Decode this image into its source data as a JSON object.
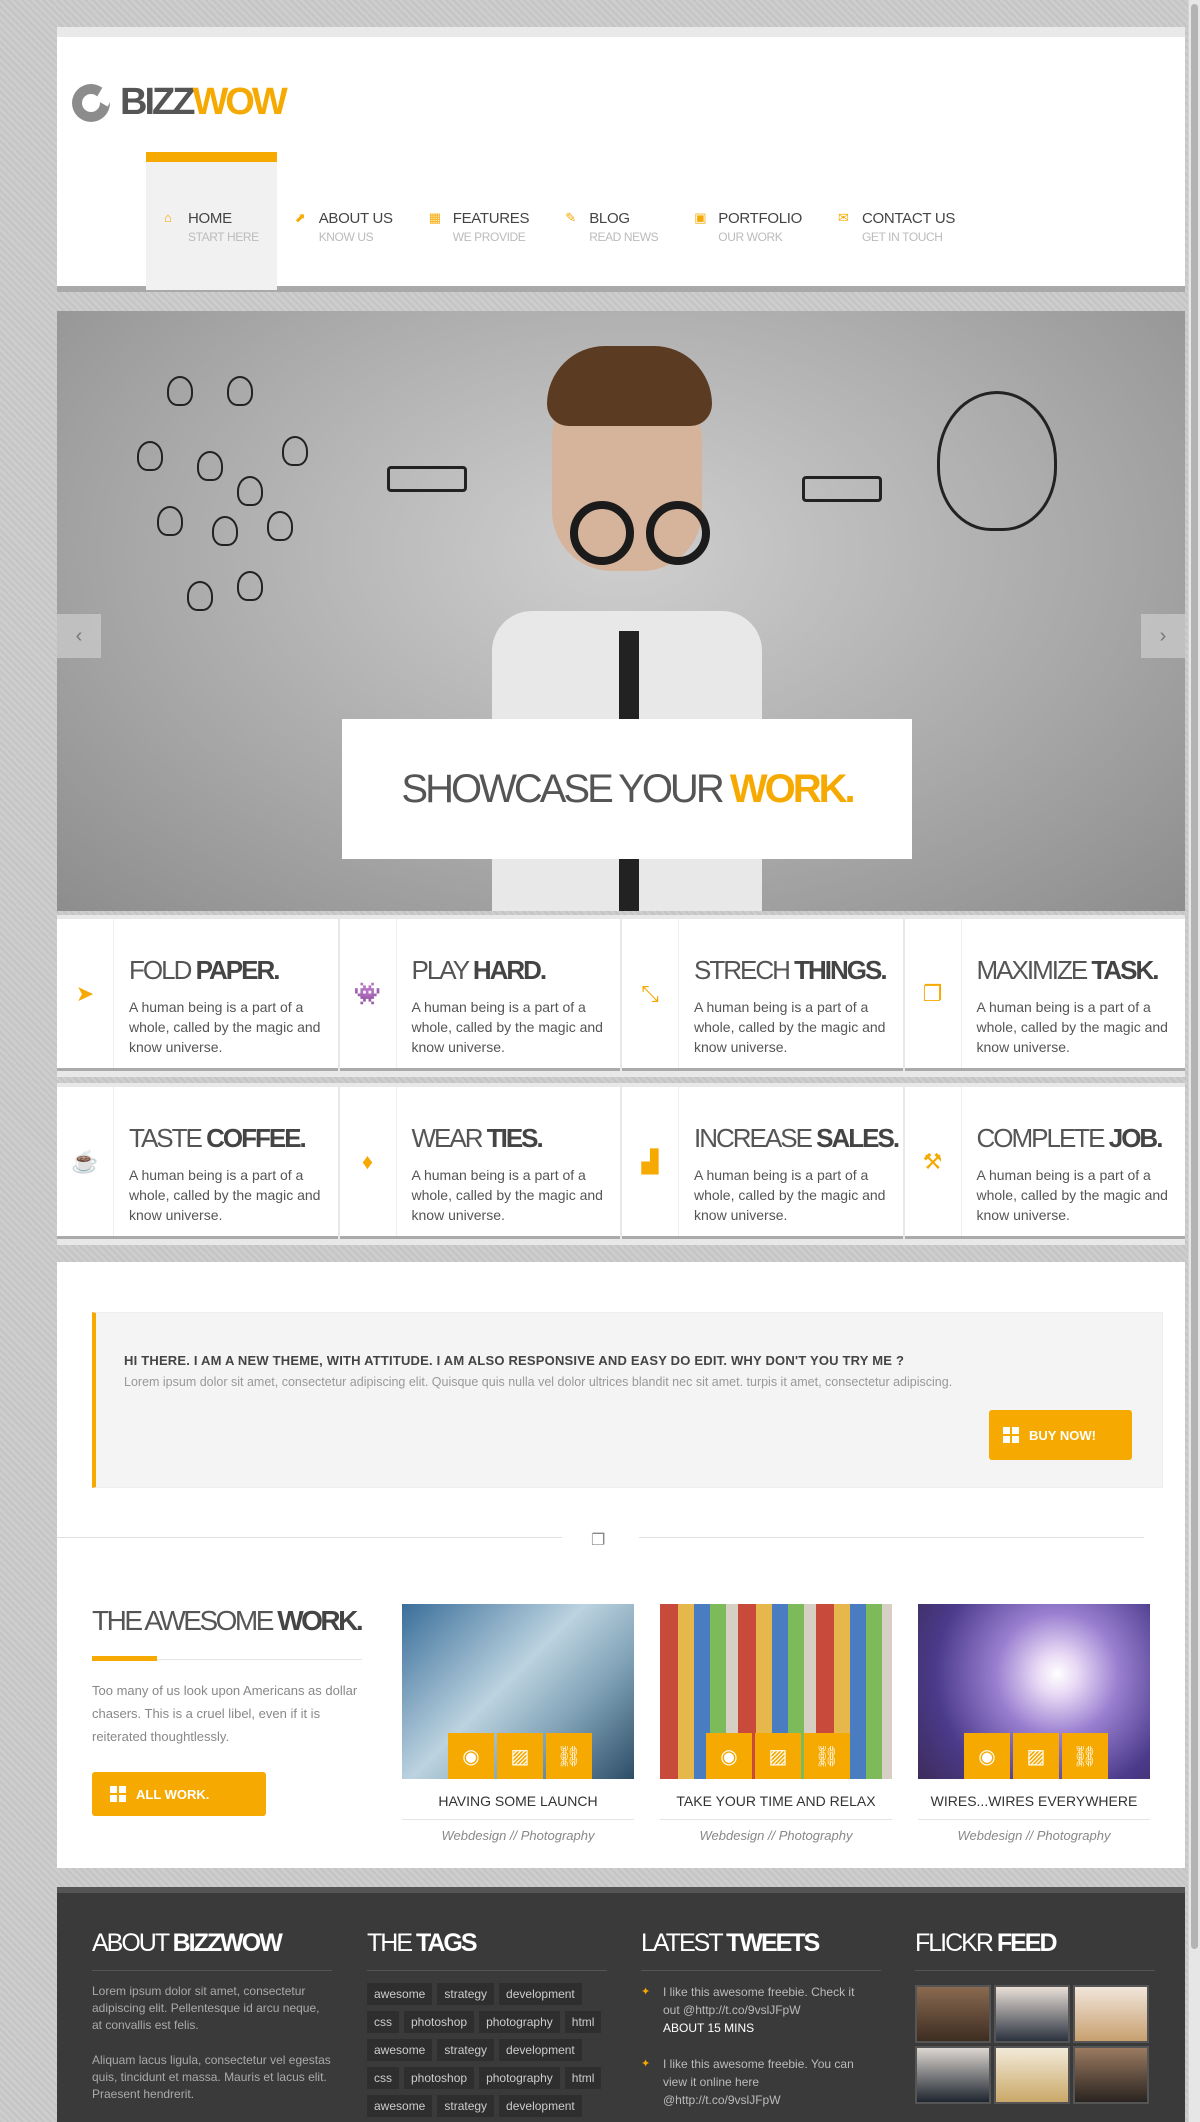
{
  "logo": {
    "part1": "BIZZ",
    "part2": "WOW"
  },
  "nav": [
    {
      "label": "HOME",
      "sub": "START HERE",
      "icon": "home-icon"
    },
    {
      "label": "ABOUT US",
      "sub": "KNOW US",
      "icon": "share-icon"
    },
    {
      "label": "FEATURES",
      "sub": "WE PROVIDE",
      "icon": "grid-icon"
    },
    {
      "label": "BLOG",
      "sub": "READ NEWS",
      "icon": "edit-icon"
    },
    {
      "label": "PORTFOLIO",
      "sub": "OUR WORK",
      "icon": "briefcase-icon"
    },
    {
      "label": "CONTACT US",
      "sub": "GET IN TOUCH",
      "icon": "mail-icon"
    }
  ],
  "slider": {
    "caption_a": "SHOWCASE YOUR ",
    "caption_b": "WORK.",
    "prev": "‹",
    "next": "›"
  },
  "features": [
    {
      "t1": "FOLD ",
      "t2": "PAPER.",
      "icon": "paper-plane-icon",
      "glyph": "➤"
    },
    {
      "t1": "PLAY ",
      "t2": "HARD.",
      "icon": "game-icon",
      "glyph": "👾"
    },
    {
      "t1": "STRECH ",
      "t2": "THINGS.",
      "icon": "expand-icon",
      "glyph": "⤡"
    },
    {
      "t1": "MAXIMIZE ",
      "t2": "TASK.",
      "icon": "stack-icon",
      "glyph": "❐"
    },
    {
      "t1": "TASTE ",
      "t2": "COFFEE.",
      "icon": "coffee-icon",
      "glyph": "☕"
    },
    {
      "t1": "WEAR ",
      "t2": "TIES.",
      "icon": "tie-icon",
      "glyph": "♦"
    },
    {
      "t1": "INCREASE ",
      "t2": "SALES.",
      "icon": "chart-icon",
      "glyph": "▟"
    },
    {
      "t1": "COMPLETE ",
      "t2": "JOB.",
      "icon": "gavel-icon",
      "glyph": "⚒"
    }
  ],
  "feature_text": "A human being is a part of a whole, called by the magic and know universe.",
  "callout": {
    "title": "HI THERE. I AM A NEW THEME, WITH ATTITUDE. I AM ALSO RESPONSIVE AND EASY DO EDIT. WHY DON'T YOU TRY ME ?",
    "text": "Lorem ipsum dolor sit amet, consectetur adipiscing elit. Quisque quis nulla vel dolor ultrices blandit nec sit amet. turpis it amet, consectetur adipiscing.",
    "button": "BUY NOW!"
  },
  "awesome": {
    "t1": "THE AWESOME ",
    "t2": "WORK.",
    "text": "Too many of us look upon Americans as dollar chasers. This is a cruel libel, even if it is reiterated thoughtlessly.",
    "button": "ALL WORK."
  },
  "works": [
    {
      "title": "HAVING SOME LAUNCH",
      "sub": "Webdesign // Photography"
    },
    {
      "title": "TAKE YOUR TIME AND RELAX",
      "sub": "Webdesign // Photography"
    },
    {
      "title": "WIRES...WIRES EVERYWHERE",
      "sub": "Webdesign // Photography"
    }
  ],
  "footer": {
    "about": {
      "t1": "ABOUT ",
      "t2": "BIZZWOW",
      "p1": "Lorem ipsum dolor sit amet, consectetur adipiscing elit. Pellentesque id arcu neque, at convallis est felis.",
      "p2": "Aliquam lacus ligula, consectetur vel egestas quis, tincidunt et massa. Mauris et lacus elit. Praesent hendrerit."
    },
    "tags": {
      "t1": "THE ",
      "t2": "TAGS",
      "items": [
        "awesome",
        "strategy",
        "development",
        "css",
        "photoshop",
        "photography",
        "html",
        "awesome",
        "strategy",
        "development",
        "css",
        "photoshop",
        "photography",
        "html",
        "awesome",
        "strategy",
        "development"
      ]
    },
    "tweets": {
      "t1": "LATEST ",
      "t2": "TWEETS",
      "items": [
        {
          "text": "I like this awesome freebie. Check it out @http://t.co/9vslJFpW",
          "time": "ABOUT 15 MINS"
        },
        {
          "text": "I like this awesome freebie. You can view it online here @http://t.co/9vslJFpW",
          "time": ""
        }
      ]
    },
    "flickr": {
      "t1": "FLICKR ",
      "t2": "FEED"
    }
  },
  "colors": {
    "accent": "#f6a900",
    "dark": "#3a3a3a"
  }
}
